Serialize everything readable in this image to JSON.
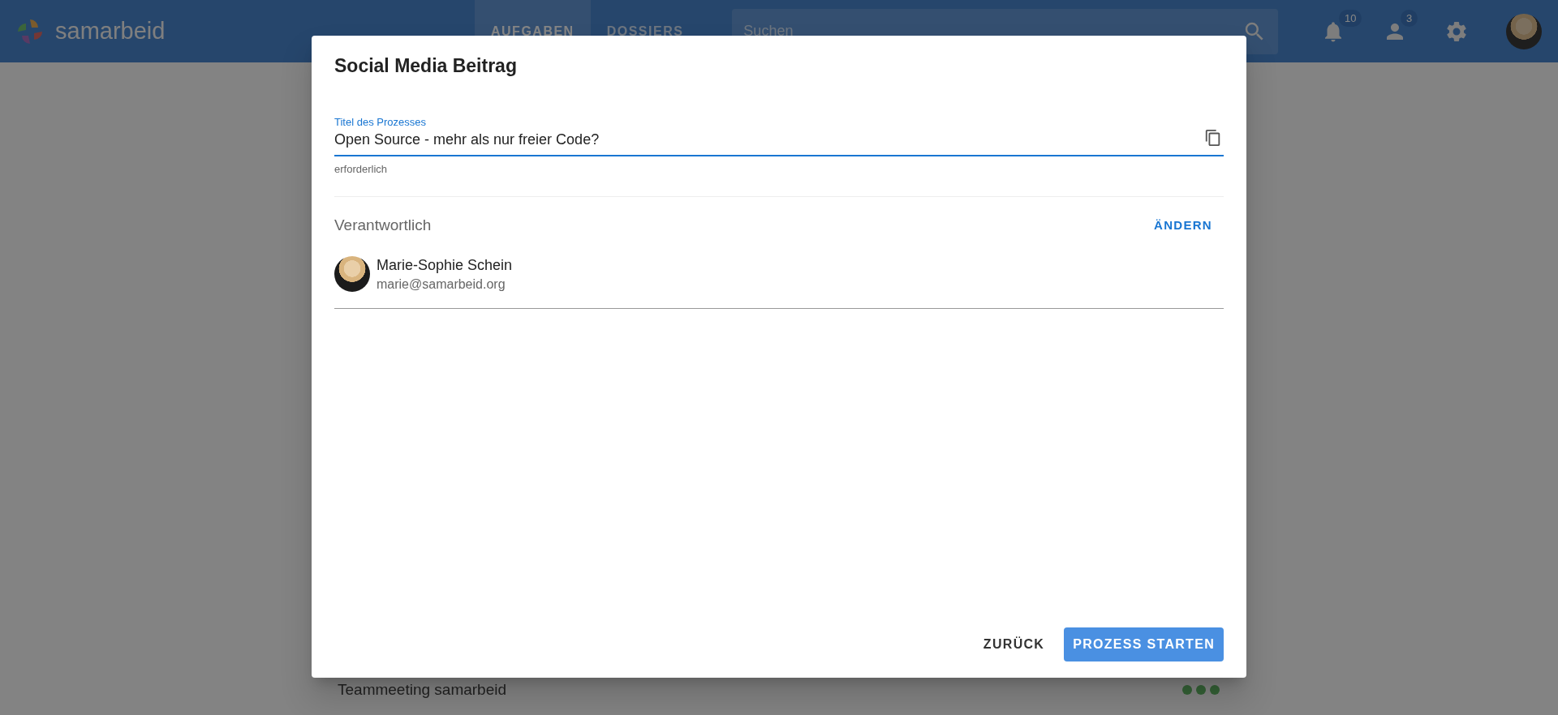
{
  "header": {
    "logo_text": "samarbeid",
    "tabs": [
      {
        "label": "AUFGABEN",
        "selected": true
      },
      {
        "label": "DOSSIERS",
        "selected": false
      }
    ],
    "search": {
      "placeholder": "Suchen"
    },
    "notifications": {
      "count": "10"
    },
    "contacts": {
      "count": "3"
    }
  },
  "background_list": [
    {
      "title": "Teammeeting samarbeid"
    }
  ],
  "dialog": {
    "title": "Social Media Beitrag",
    "field": {
      "label": "Titel des Prozesses",
      "value": "Open Source - mehr als nur freier Code?",
      "hint": "erforderlich"
    },
    "responsible": {
      "heading": "Verantwortlich",
      "action": "ÄNDERN",
      "person": {
        "name": "Marie-Sophie Schein",
        "email": "marie@samarbeid.org"
      }
    },
    "buttons": [
      {
        "label": "ZURÜCK",
        "kind": "text"
      },
      {
        "label": "PROZESS STARTEN",
        "kind": "primary"
      }
    ]
  }
}
